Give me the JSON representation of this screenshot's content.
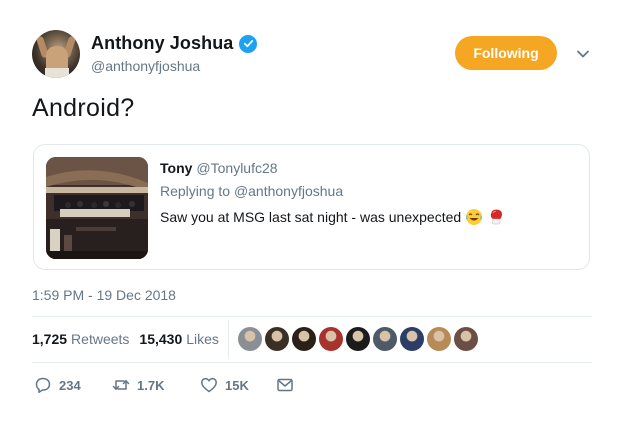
{
  "author": {
    "display_name": "Anthony Joshua",
    "handle": "@anthonyfjoshua",
    "verified": true
  },
  "follow_button": {
    "label": "Following",
    "color": "#f5a623"
  },
  "tweet": {
    "text": "Android?",
    "timestamp": "1:59 PM - 19 Dec 2018"
  },
  "quoted_tweet": {
    "name": "Tony",
    "handle": "@Tonylufc28",
    "replying_prefix": "Replying to",
    "replying_handle": "@anthonyfjoshua",
    "text": "Saw you at MSG last sat night - was unexpected",
    "emojis": [
      "face-with-tears-of-joy-icon",
      "boxing-glove-icon"
    ]
  },
  "stats": {
    "retweets_count": "1,725",
    "retweets_label": "Retweets",
    "likes_count": "15,430",
    "likes_label": "Likes"
  },
  "likers": [
    {
      "color": "#8a8f95"
    },
    {
      "color": "#3a3026"
    },
    {
      "color": "#2b2018"
    },
    {
      "color": "#a8322e"
    },
    {
      "color": "#1b1b1b"
    },
    {
      "color": "#4e5a66"
    },
    {
      "color": "#2c3e66"
    },
    {
      "color": "#b88a58"
    },
    {
      "color": "#6b4e45"
    }
  ],
  "actions": {
    "replies": "234",
    "retweets": "1.7K",
    "likes": "15K"
  },
  "colors": {
    "text_primary": "#14171a",
    "text_secondary": "#657786",
    "verified_blue": "#1da1f2",
    "border": "#e1e8ed"
  }
}
